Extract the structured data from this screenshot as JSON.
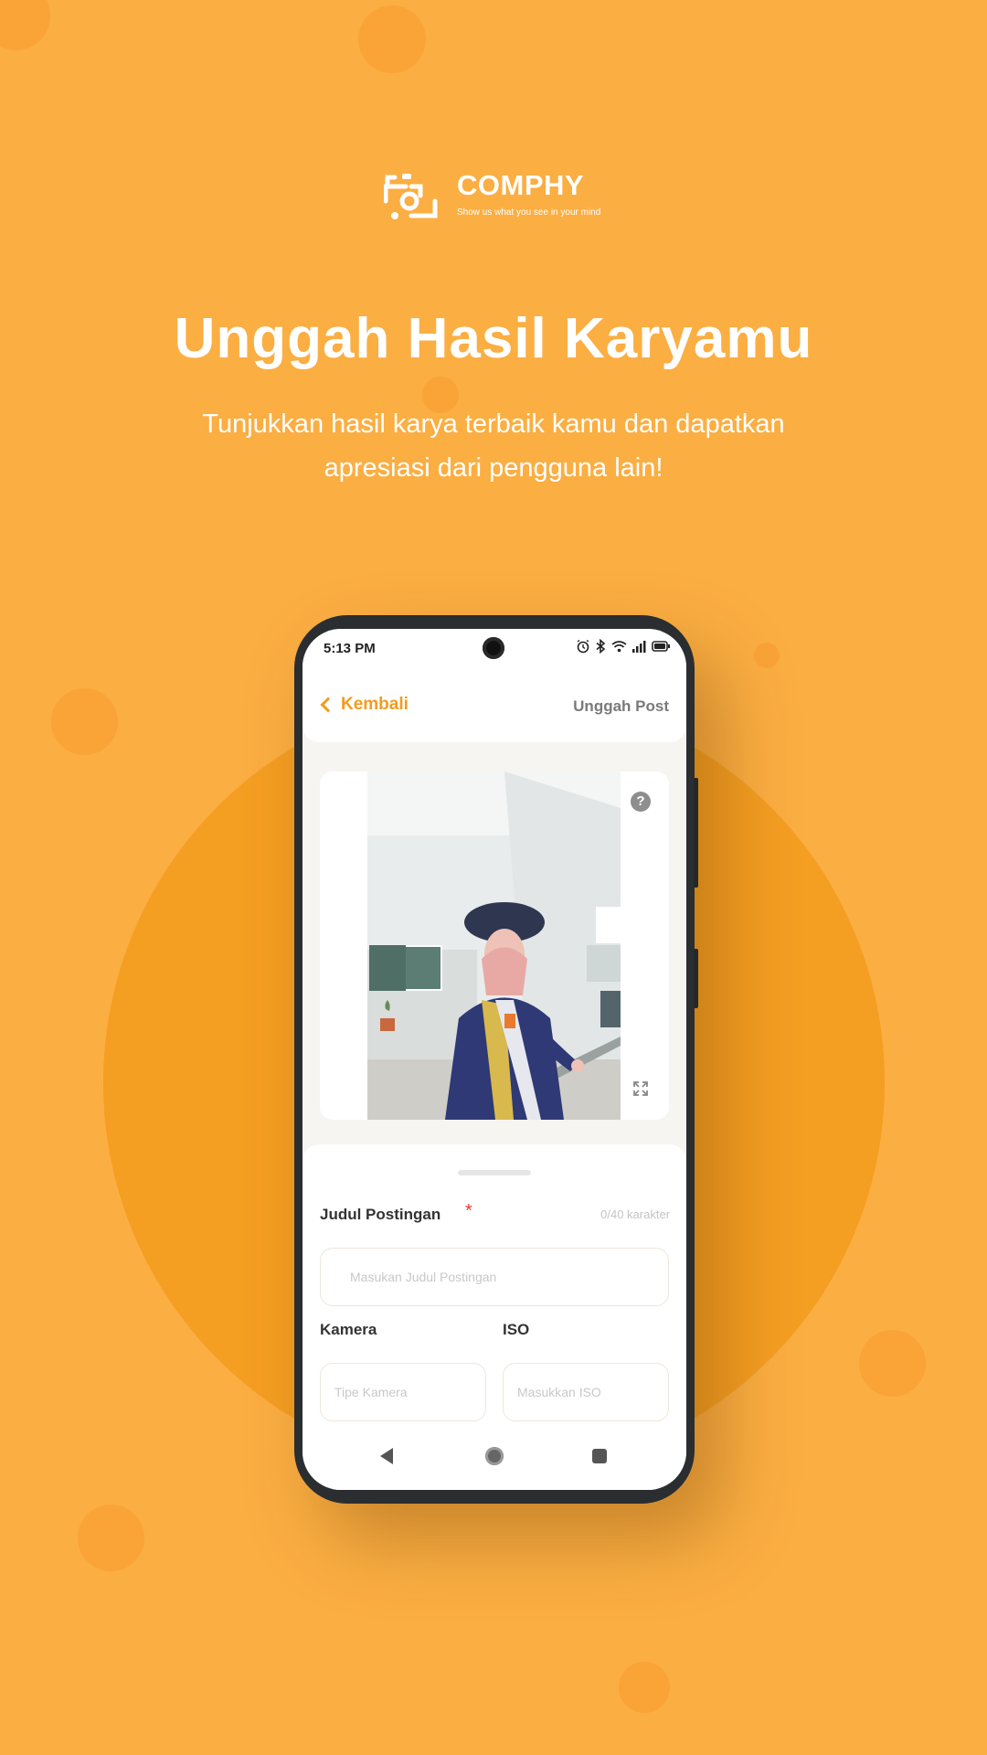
{
  "brand": {
    "name": "COMPHY",
    "tagline": "Show us what you see in your mind"
  },
  "hero": {
    "title": "Unggah Hasil Karyamu",
    "subtitle": "Tunjukkan hasil karya terbaik kamu dan dapatkan apresiasi dari pengguna lain!"
  },
  "colors": {
    "background": "#FBAE42",
    "accent": "#F39C1F",
    "circle": "#F49E22",
    "required": "#E53935"
  },
  "phone": {
    "status_bar": {
      "time": "5:13 PM",
      "icons": [
        "alarm-icon",
        "bluetooth-icon",
        "wifi-icon",
        "signal-icon",
        "battery-icon"
      ]
    },
    "app_bar": {
      "back_label": "Kembali",
      "title": "Unggah Post"
    },
    "image_card": {
      "help_icon": "?",
      "expand_icon": "expand-icon"
    },
    "form": {
      "title_label": "Judul Postingan",
      "required_mark": "*",
      "counter": "0/40 karakter",
      "title_placeholder": "Masukan Judul Postingan",
      "camera_label": "Kamera",
      "camera_placeholder": "Tipe Kamera",
      "iso_label": "ISO",
      "iso_placeholder": "Masukkan ISO"
    },
    "nav_bar": {
      "buttons": [
        "back-nav-icon",
        "home-nav-icon",
        "recents-nav-icon"
      ]
    }
  }
}
